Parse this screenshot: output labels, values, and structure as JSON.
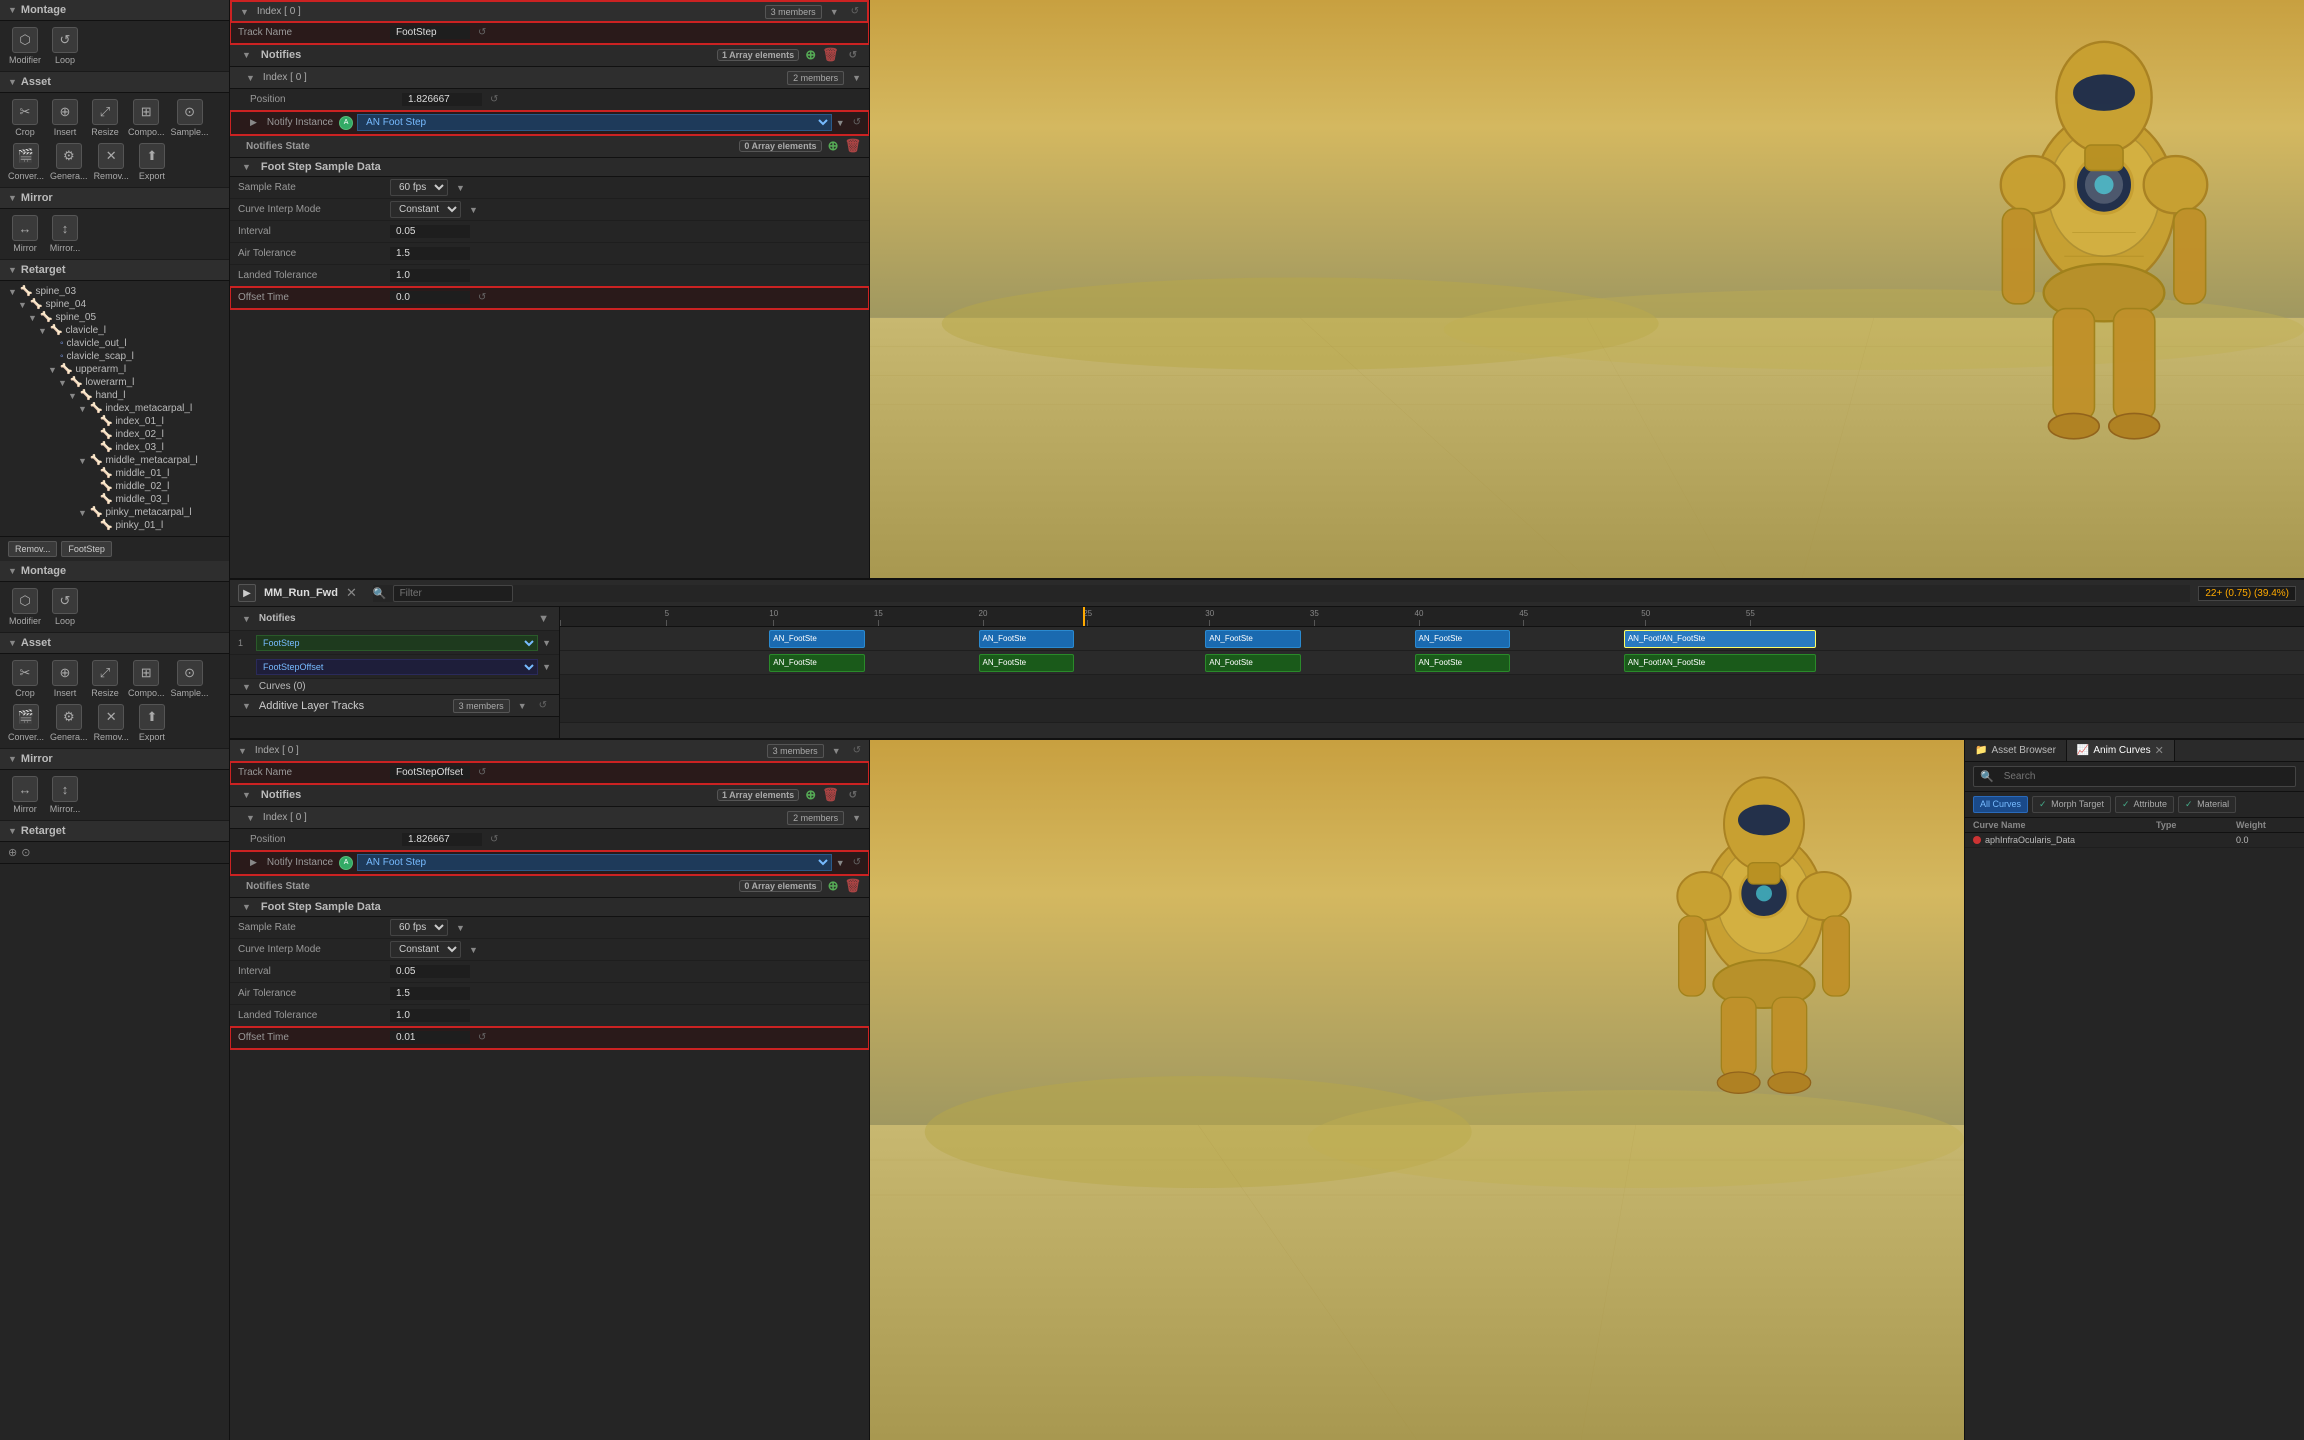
{
  "sidebar": {
    "sections": [
      {
        "name": "Montage",
        "tools": [
          {
            "icon": "⬡",
            "label": "Modifier"
          },
          {
            "icon": "↺",
            "label": "Loop"
          }
        ]
      },
      {
        "name": "Asset",
        "tools": [
          {
            "icon": "✂",
            "label": "Crop"
          },
          {
            "icon": "⊕",
            "label": "Insert"
          },
          {
            "icon": "⤢",
            "label": "Resize"
          },
          {
            "icon": "⊞",
            "label": "Compo..."
          },
          {
            "icon": "⊙",
            "label": "Sample..."
          },
          {
            "icon": "🎬",
            "label": "Conver..."
          },
          {
            "icon": "⚙",
            "label": "Genera..."
          },
          {
            "icon": "✕",
            "label": "Remov..."
          },
          {
            "icon": "⬆",
            "label": "Export"
          }
        ]
      },
      {
        "name": "Mirror",
        "tools": [
          {
            "icon": "↔",
            "label": "Mirror"
          },
          {
            "icon": "↕",
            "label": "Mirror..."
          }
        ]
      },
      {
        "name": "Retarget",
        "tree_items": [
          {
            "indent": 0,
            "label": "spine_03",
            "icon": "bone",
            "has_arrow": true
          },
          {
            "indent": 1,
            "label": "spine_04",
            "icon": "bone",
            "has_arrow": true
          },
          {
            "indent": 2,
            "label": "spine_05",
            "icon": "bone",
            "has_arrow": true
          },
          {
            "indent": 3,
            "label": "clavicle_l",
            "icon": "bone",
            "has_arrow": true
          },
          {
            "indent": 4,
            "label": "clavicle_out_l",
            "icon": "bone",
            "has_arrow": false
          },
          {
            "indent": 4,
            "label": "clavicle_scap_l",
            "icon": "bone",
            "has_arrow": false
          },
          {
            "indent": 4,
            "label": "upperarm_l",
            "icon": "bone",
            "has_arrow": true
          },
          {
            "indent": 5,
            "label": "lowerarm_l",
            "icon": "bone",
            "has_arrow": true
          },
          {
            "indent": 6,
            "label": "hand_l",
            "icon": "bone",
            "has_arrow": true
          },
          {
            "indent": 7,
            "label": "index_metacarpal_l",
            "icon": "bone",
            "has_arrow": true
          },
          {
            "indent": 8,
            "label": "index_01_l",
            "icon": "bone",
            "has_arrow": false
          },
          {
            "indent": 8,
            "label": "index_02_l",
            "icon": "bone",
            "has_arrow": false
          },
          {
            "indent": 8,
            "label": "index_03_l",
            "icon": "bone",
            "has_arrow": false
          },
          {
            "indent": 7,
            "label": "middle_metacarpal_l",
            "icon": "bone",
            "has_arrow": true
          },
          {
            "indent": 8,
            "label": "middle_01_l",
            "icon": "bone",
            "has_arrow": false
          },
          {
            "indent": 8,
            "label": "middle_02_l",
            "icon": "bone",
            "has_arrow": false
          },
          {
            "indent": 8,
            "label": "middle_03_l",
            "icon": "bone",
            "has_arrow": false
          },
          {
            "indent": 7,
            "label": "pinky_metacarpal_l",
            "icon": "bone",
            "has_arrow": true
          },
          {
            "indent": 8,
            "label": "pinky_01_l",
            "icon": "bone",
            "has_arrow": false
          }
        ]
      }
    ],
    "bottom_buttons": [
      "Remov...",
      "FootStep"
    ]
  },
  "sidebar2": {
    "sections": [
      {
        "name": "Montage",
        "tools": [
          {
            "icon": "⬡",
            "label": "Modifier"
          },
          {
            "icon": "↺",
            "label": "Loop"
          }
        ]
      },
      {
        "name": "Asset",
        "tools": [
          {
            "icon": "✂",
            "label": "Crop"
          },
          {
            "icon": "⊕",
            "label": "Insert"
          },
          {
            "icon": "⤢",
            "label": "Resize"
          },
          {
            "icon": "⊞",
            "label": "Compo..."
          },
          {
            "icon": "⊙",
            "label": "Sample..."
          },
          {
            "icon": "🎬",
            "label": "Conver..."
          },
          {
            "icon": "⚙",
            "label": "Genera..."
          },
          {
            "icon": "✕",
            "label": "Remov..."
          },
          {
            "icon": "⬆",
            "label": "Export"
          }
        ]
      },
      {
        "name": "Mirror",
        "tools": [
          {
            "icon": "↔",
            "label": "Mirror"
          },
          {
            "icon": "↕",
            "label": "Mirror..."
          }
        ]
      }
    ]
  },
  "top_properties": {
    "index0": {
      "label": "Index [ 0 ]",
      "member_count": "3 members",
      "track_name_label": "Track Name",
      "track_name_value": "FootStep",
      "notifies_label": "Notifies",
      "notifies_count": "1 Array elements",
      "index_inner_label": "Index [ 0 ]",
      "index_inner_count": "2 members",
      "position_label": "Position",
      "position_value": "1.826667",
      "notify_instance_label": "Notify Instance",
      "notify_instance_value": "AN Foot Step",
      "notifies_state_label": "Notifies State",
      "notifies_state_count": "0 Array elements",
      "foot_step_label": "Foot Step Sample Data",
      "sample_rate_label": "Sample Rate",
      "sample_rate_value": "60 fps",
      "curve_interp_label": "Curve Interp Mode",
      "curve_interp_value": "Constant",
      "interval_label": "Interval",
      "interval_value": "0.05",
      "air_tolerance_label": "Air Tolerance",
      "air_tolerance_value": "1.5",
      "landed_tolerance_label": "Landed Tolerance",
      "landed_tolerance_value": "1.0",
      "offset_time_label": "Offset Time",
      "offset_time_value": "0.0"
    }
  },
  "bottom_properties": {
    "index0": {
      "label": "Index [ 0 ]",
      "member_count": "3 members",
      "track_name_label": "Track Name",
      "track_name_value": "FootStepOffset",
      "notifies_label": "Notifies",
      "notifies_count": "1 Array elements",
      "index_inner_label": "Index [ 0 ]",
      "index_inner_count": "2 members",
      "position_label": "Position",
      "position_value": "1.826667",
      "notify_instance_label": "Notify Instance",
      "notify_instance_value": "AN Foot Step",
      "notifies_state_label": "Notifies State",
      "notifies_state_count": "0 Array elements",
      "foot_step_label": "Foot Step Sample Data",
      "sample_rate_label": "Sample Rate",
      "sample_rate_value": "60 fps",
      "curve_interp_label": "Curve Interp Mode",
      "curve_interp_value": "Constant",
      "interval_label": "Interval",
      "interval_value": "0.05",
      "air_tolerance_label": "Air Tolerance",
      "air_tolerance_value": "1.5",
      "landed_tolerance_label": "Landed Tolerance",
      "landed_tolerance_value": "1.0",
      "offset_time_label": "Offset Time",
      "offset_time_value": "0.01"
    }
  },
  "timeline": {
    "animation_name": "MM_Run_Fwd",
    "frame_count": "22+",
    "frame_info": "22+ (0.75) (39.4%)",
    "filter_placeholder": "Filter",
    "notifies_label": "Notifies",
    "tracks": [
      {
        "number": "1",
        "name": "FootStep",
        "clips": [
          {
            "label": "AN_FootSte",
            "left": "14%",
            "width": "6%"
          },
          {
            "label": "AN_FootSte",
            "left": "26%",
            "width": "6%"
          },
          {
            "label": "AN_FootSte",
            "left": "38%",
            "width": "6%"
          },
          {
            "label": "AN_FootSte",
            "left": "50%",
            "width": "6%"
          },
          {
            "label": "AN_Foot!AN_FootSte",
            "left": "62%",
            "width": "12%"
          }
        ]
      },
      {
        "number": "",
        "name": "FootStepOffset",
        "clips": [
          {
            "label": "AN_FootSte",
            "left": "14%",
            "width": "6%"
          },
          {
            "label": "AN_FootSte",
            "left": "26%",
            "width": "6%"
          },
          {
            "label": "AN_FootSte",
            "left": "38%",
            "width": "6%"
          },
          {
            "label": "AN_FootSte",
            "left": "50%",
            "width": "6%"
          },
          {
            "label": "AN_Foot!AN_FootSte",
            "left": "62%",
            "width": "12%"
          }
        ]
      }
    ],
    "curves_label": "Curves (0)",
    "additive_layer_label": "Additive Layer Tracks",
    "additive_layer_count": "3 members",
    "ruler_ticks": [
      {
        "pos": "0%",
        "label": ""
      },
      {
        "pos": "6%",
        "label": "5"
      },
      {
        "pos": "12%",
        "label": "10"
      },
      {
        "pos": "18%",
        "label": "15"
      },
      {
        "pos": "24%",
        "label": "20"
      },
      {
        "pos": "30%",
        "label": "25"
      },
      {
        "pos": "37%",
        "label": "30"
      },
      {
        "pos": "43%",
        "label": "35"
      },
      {
        "pos": "49%",
        "label": "40"
      },
      {
        "pos": "55%",
        "label": "45"
      },
      {
        "pos": "62%",
        "label": "50"
      },
      {
        "pos": "68%",
        "label": "55"
      }
    ],
    "playhead_pos": "30%"
  },
  "asset_browser": {
    "tab1": "Asset Browser",
    "tab2": "Anim Curves",
    "search_placeholder": "Search",
    "filter_all": "All Curves",
    "filter_morph": "Morph Target",
    "filter_attr": "Attribute",
    "filter_material": "Material",
    "table_header_name": "Curve Name",
    "table_header_type": "Type",
    "table_header_weight": "Weight",
    "curves": [
      {
        "name": "aphInfraOcularis_Data",
        "type": "",
        "weight": "0.0"
      }
    ]
  }
}
